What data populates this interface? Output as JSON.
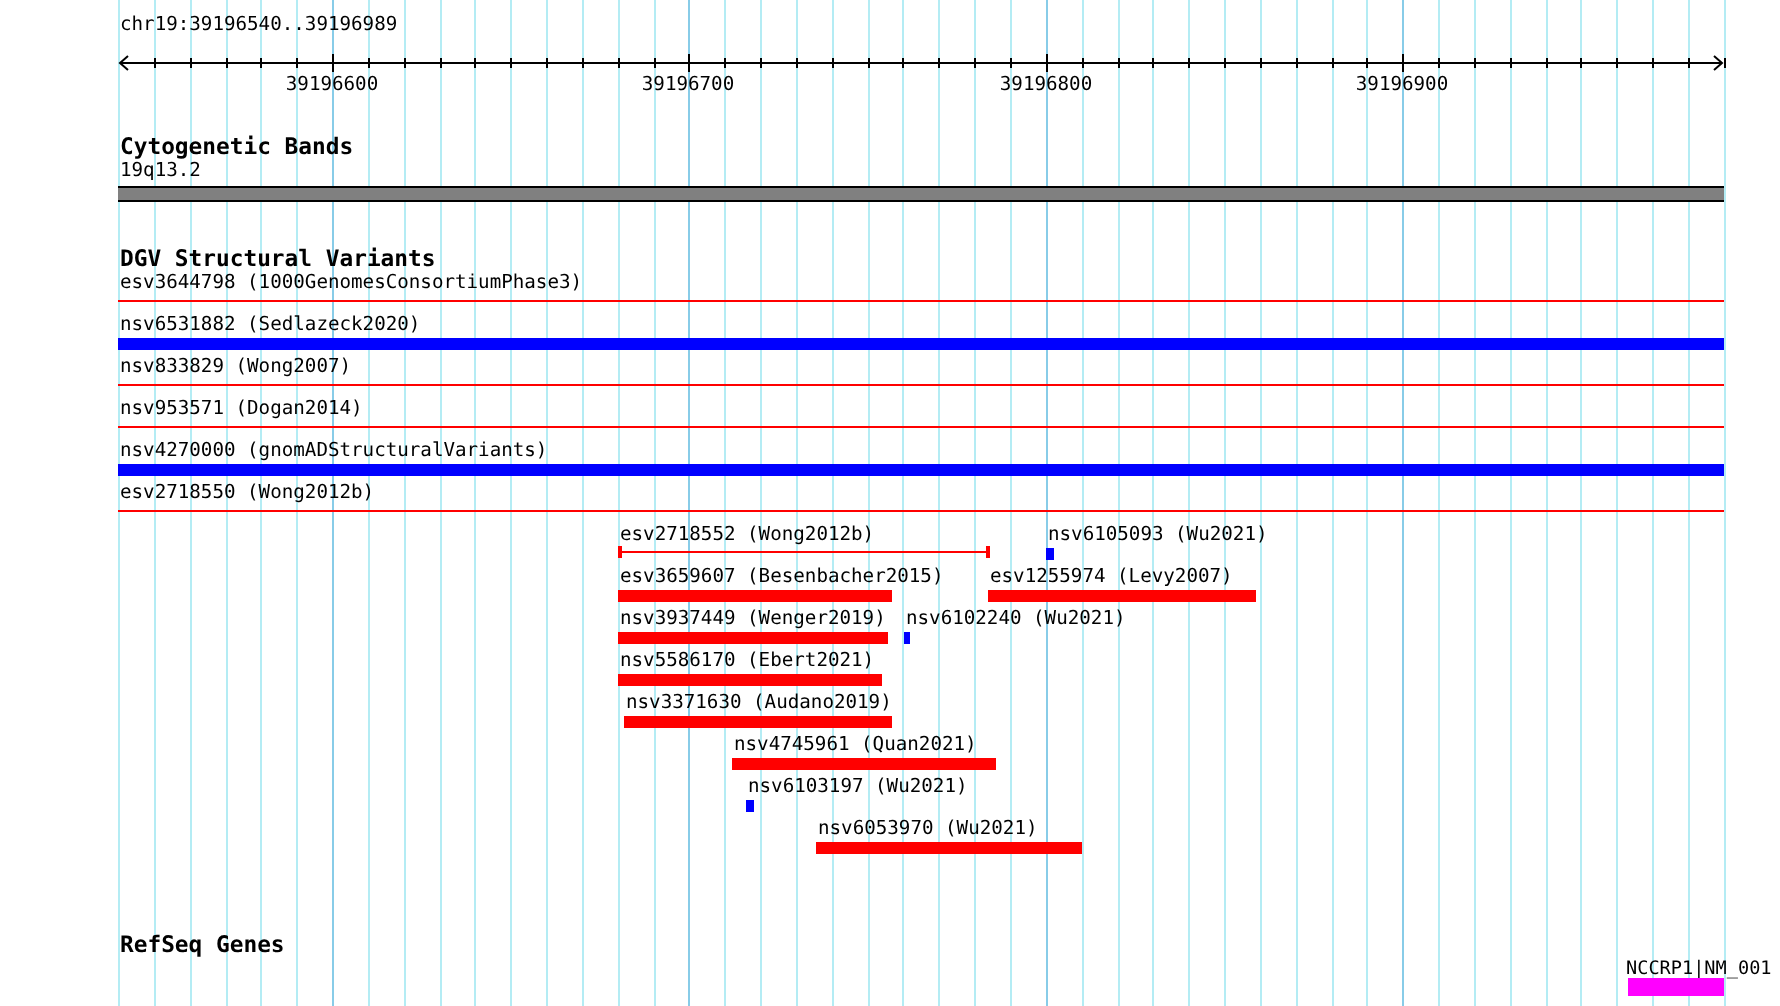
{
  "ruler": {
    "label": "chr19:39196540..39196989",
    "tick_labels": [
      "39196600",
      "39196700",
      "39196800",
      "39196900"
    ]
  },
  "tracks": [
    {
      "title": "Cytogenetic Bands",
      "kind": "band",
      "rows": [
        [
          {
            "kind": "band",
            "label": "19q13.2",
            "color": "#808080"
          }
        ]
      ]
    },
    {
      "title": "DGV Structural Variants",
      "kind": "variants",
      "rows": [
        [
          {
            "kind": "line",
            "label": "esv3644798 (1000GenomesConsortiumPhase3)",
            "color": "#ff0000"
          }
        ],
        [
          {
            "kind": "bar",
            "label": "nsv6531882 (Sedlazeck2020)",
            "color": "#0000ff"
          }
        ],
        [
          {
            "kind": "line",
            "label": "nsv833829 (Wong2007)",
            "color": "#ff0000"
          }
        ],
        [
          {
            "kind": "line",
            "label": "nsv953571 (Dogan2014)",
            "color": "#ff0000"
          }
        ],
        [
          {
            "kind": "bar",
            "label": "nsv4270000 (gnomADStructuralVariants)",
            "color": "#0000ff"
          }
        ],
        [
          {
            "kind": "line",
            "label": "esv2718550 (Wong2012b)",
            "color": "#ff0000"
          }
        ],
        [
          {
            "kind": "span",
            "label": "esv2718552 (Wong2012b)",
            "color": "#ff0000"
          },
          {
            "kind": "bar",
            "label": "nsv6105093 (Wu2021)",
            "color": "#0000ff"
          }
        ],
        [
          {
            "kind": "bar",
            "label": "esv3659607 (Besenbacher2015)",
            "color": "#ff0000"
          },
          {
            "kind": "bar",
            "label": "esv1255974 (Levy2007)",
            "color": "#ff0000"
          }
        ],
        [
          {
            "kind": "bar",
            "label": "nsv3937449 (Wenger2019)",
            "color": "#ff0000"
          },
          {
            "kind": "bar",
            "label": "nsv6102240 (Wu2021)",
            "color": "#0000ff"
          }
        ],
        [
          {
            "kind": "bar",
            "label": "nsv5586170 (Ebert2021)",
            "color": "#ff0000"
          }
        ],
        [
          {
            "kind": "bar",
            "label": "nsv3371630 (Audano2019)",
            "color": "#ff0000"
          }
        ],
        [
          {
            "kind": "bar",
            "label": "nsv4745961 (Quan2021)",
            "color": "#ff0000"
          }
        ],
        [
          {
            "kind": "bar",
            "label": "nsv6103197 (Wu2021)",
            "color": "#0000ff"
          }
        ],
        [
          {
            "kind": "bar",
            "label": "nsv6053970 (Wu2021)",
            "color": "#ff0000"
          }
        ]
      ]
    },
    {
      "title": "RefSeq Genes",
      "kind": "genes",
      "rows": [
        [
          {
            "kind": "gene",
            "label": "NCCRP1|NM_001",
            "color": "#ff00ff"
          }
        ]
      ]
    }
  ]
}
